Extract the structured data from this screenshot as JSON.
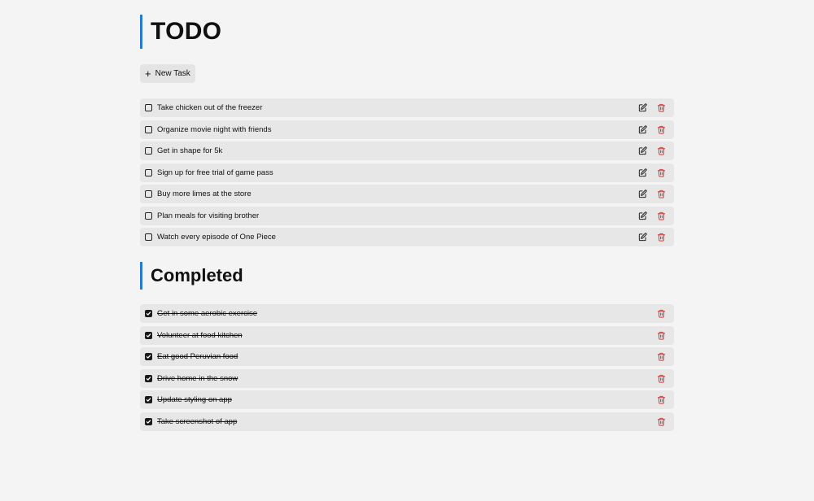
{
  "todo_section": {
    "title": "TODO",
    "new_task_label": "New Task",
    "tasks": [
      {
        "text": "Take chicken out of the freezer"
      },
      {
        "text": "Organize movie night with friends"
      },
      {
        "text": "Get in shape for 5k"
      },
      {
        "text": "Sign up for free trial of game pass"
      },
      {
        "text": "Buy more limes at the store"
      },
      {
        "text": "Plan meals for visiting brother"
      },
      {
        "text": "Watch every episode of One Piece"
      }
    ]
  },
  "completed_section": {
    "title": "Completed",
    "tasks": [
      {
        "text": "Get in some aerobic exercise"
      },
      {
        "text": "Volunteer at food kitchen"
      },
      {
        "text": "Eat good Peruvian food"
      },
      {
        "text": "Drive home in the snow"
      },
      {
        "text": "Update styling on app"
      },
      {
        "text": "Take screenshot of app"
      }
    ]
  },
  "icons": {
    "new_task": "plus-icon",
    "edit": "edit-icon",
    "delete": "trash-icon",
    "checkbox_empty": "checkbox-icon",
    "checkbox_checked": "checkbox-checked-icon"
  },
  "colors": {
    "accent": "#2a78d6",
    "delete": "#d93a3a",
    "row_background": "#e7e7e7",
    "page_background": "#f4f4f4"
  }
}
